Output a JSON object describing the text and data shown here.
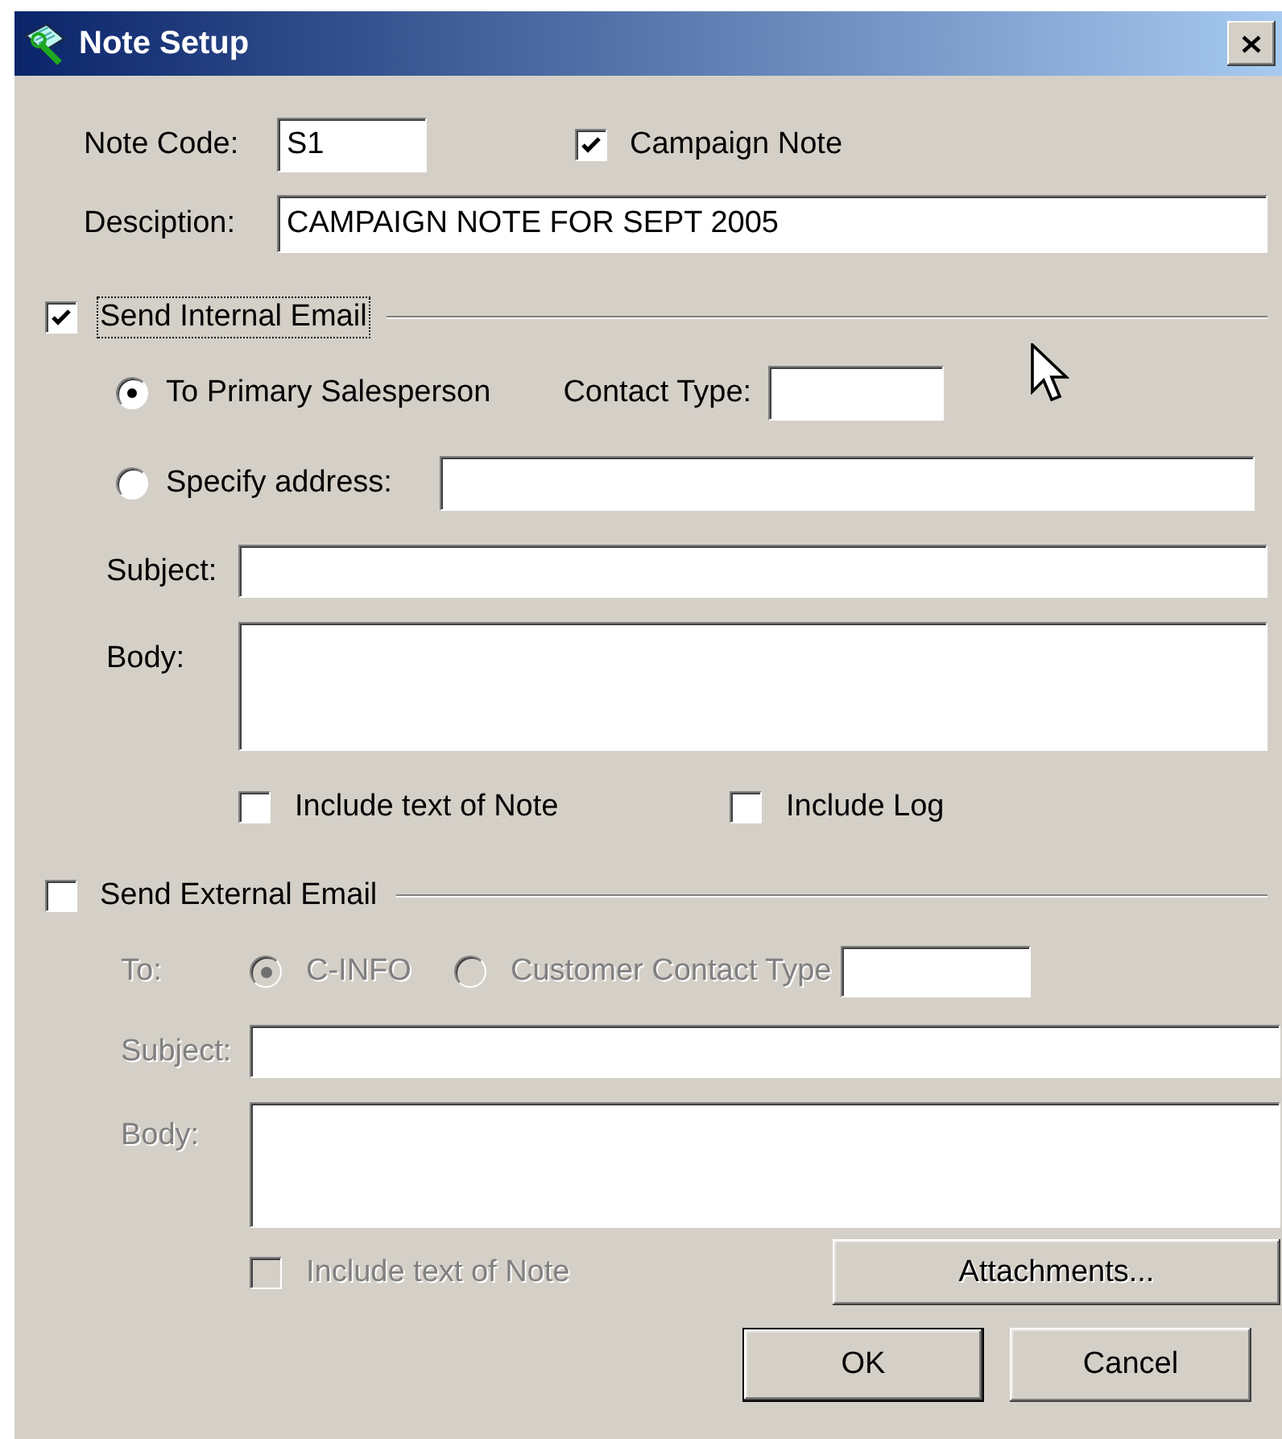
{
  "window": {
    "title": "Note Setup"
  },
  "note_code": {
    "label": "Note Code:",
    "value": "S1"
  },
  "campaign_note": {
    "label": "Campaign Note",
    "checked": true
  },
  "description": {
    "label": "Desciption:",
    "value": "CAMPAIGN NOTE FOR SEPT 2005"
  },
  "internal_email": {
    "label": "Send Internal Email",
    "checked": true,
    "focused": true,
    "recipients": [
      {
        "label": "To Primary Salesperson",
        "selected": true
      },
      {
        "label": "Specify address:",
        "selected": false
      }
    ],
    "contact_type": {
      "label": "Contact Type:"
    },
    "subject": {
      "label": "Subject:"
    },
    "body": {
      "label": "Body:"
    },
    "options": [
      {
        "label": "Include text of Note",
        "checked": false
      },
      {
        "label": "Include Log",
        "checked": false
      }
    ]
  },
  "external_email": {
    "label": "Send External Email",
    "checked": false,
    "disabled": true,
    "to_label": "To:",
    "recipients": [
      {
        "label": "C-INFO",
        "selected": true
      },
      {
        "label": "Customer Contact Type",
        "selected": false
      }
    ],
    "subject": {
      "label": "Subject:"
    },
    "body": {
      "label": "Body:"
    },
    "include_note": {
      "label": "Include text of Note",
      "checked": false
    },
    "attachments_button": "Attachments..."
  },
  "buttons": [
    {
      "label": "OK",
      "default": true
    },
    {
      "label": "Cancel",
      "default": false
    }
  ]
}
